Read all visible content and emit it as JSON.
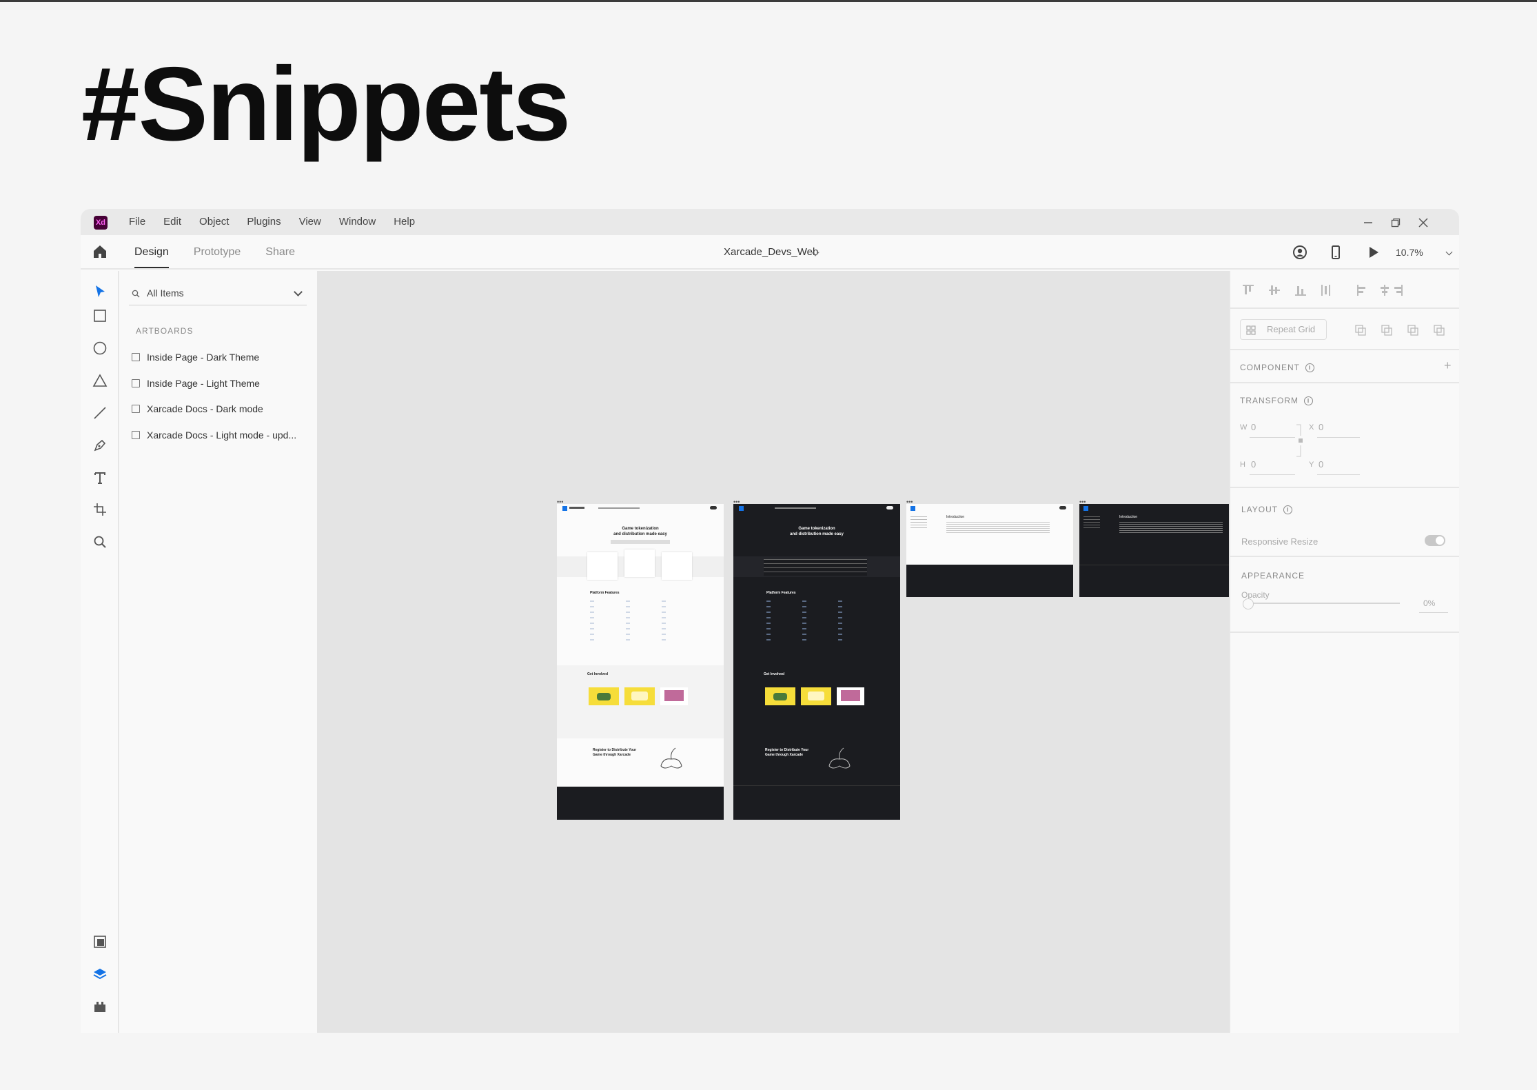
{
  "headline": "#Snippets",
  "app": {
    "logo": "Xd",
    "menu": [
      "File",
      "Edit",
      "Object",
      "Plugins",
      "View",
      "Window",
      "Help"
    ],
    "window_controls": [
      "minimize-icon",
      "restore-icon",
      "close-icon"
    ]
  },
  "toolbar": {
    "tabs": [
      {
        "label": "Design",
        "active": true
      },
      {
        "label": "Prototype",
        "active": false
      },
      {
        "label": "Share",
        "active": false
      }
    ],
    "document_title": "Xarcade_Devs_Web",
    "zoom": "10.7%"
  },
  "layers": {
    "filter": "All Items",
    "section": "ARTBOARDS",
    "artboards": [
      "Inside Page - Dark Theme",
      "Inside Page - Light Theme",
      "Xarcade Docs - Dark mode",
      "Xarcade Docs - Light mode - upd..."
    ]
  },
  "properties": {
    "repeat_grid": "Repeat Grid",
    "component": "COMPONENT",
    "transform": "TRANSFORM",
    "w_label": "W",
    "w_value": "0",
    "x_label": "X",
    "x_value": "0",
    "h_label": "H",
    "h_value": "0",
    "y_label": "Y",
    "y_value": "0",
    "layout": "LAYOUT",
    "responsive_resize": "Responsive Resize",
    "appearance": "APPEARANCE",
    "opacity_label": "Opacity",
    "opacity_value": "0%"
  },
  "artboard_texts": {
    "hero_line1": "Game tokenization",
    "hero_line2": "and distribution made easy",
    "platform_features": "Platform Features",
    "get_involved": "Get Involved",
    "register_line1": "Register to Distribute Your",
    "register_line2": "Game through Xarcade",
    "introduction": "Introduction"
  },
  "colors": {
    "accent": "#1473e6",
    "xd_brand": "#470137",
    "dark_artboard": "#1b1c20",
    "yellow": "#f6dd3a"
  }
}
